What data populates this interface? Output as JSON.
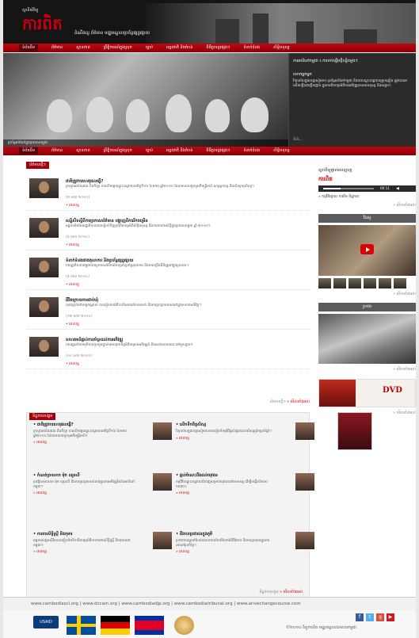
{
  "header": {
    "logo_small": "ស្ថានីយ៍វិទ្យុ",
    "logo_main": "ការពិត",
    "tagline": "ដំណឹងល្អ  ព័ត៌មាន  មជ្ឈមណ្ឌលប្រព័ន្ធផ្សព្វផ្សាយ"
  },
  "nav": [
    "ទំព័រដើម",
    "ព័ត៌មាន",
    "ស្ថានភាព",
    "ព្រឹត្តិការណ៍ក្នុងស្រុក",
    "ច្បាប់",
    "អន្តរជាតិ និងតំបន់",
    "ពិធីប្រារព្ធផ្សេងៗ",
    "ទំនាក់ទំនង",
    "សិទ្ធិមនុស្ស"
  ],
  "banner": {
    "caption": "ប្រព័ន្ធអប់រំនៅក្នុងប្រទេសកម្ពុជា",
    "title": "ការអប់រំនៅកម្ពុជា ៖ ការចាប់ផ្តើមថ្មីបន្តិចម្តងៗ",
    "heading": "លោកអ្នកអ្នក",
    "text": "វិទ្យាល័យក្នុងខេត្តសៀមរាប ប្រព័ន្ធអប់រំនៅកម្ពុជា និងការបណ្ដុះបណ្ដាលគ្រូបង្រៀន ត្រូវបានគេលើកឡើងជាញឹកញាប់ ក្នុងការពិភាក្សាអំពីការអភិវឌ្ឍធនធានមនុស្ស និងសង្គម។",
    "page_label": "ទំព័រ...",
    "more_label": "»"
  },
  "news": {
    "section_label": "ព័ត៌មានថ្មីៗ",
    "items": [
      {
        "title": "ជាតិត្រូវការហេតុផលធ្វើ?",
        "summary": "ក្រសួងអប់រំយុវជន និងកីឡា បានបើកវគ្គបណ្ដុះបណ្ដាលនៅថ្ងៃទី១៦ ខែមករា ឆ្នាំ២០១០ ដែលមានការចូលរួមពីមន្ត្រីអប់រំ សាស្ត្រាចារ្យ និងសិស្សានុសិស្ស។",
        "date": "(២ មករា ២០១០)",
        "more": "• អានបន្ត"
      },
      {
        "title": "សន្និសីទ​ស្ដីពីការប្រកាសព័ត៌មាន បង្ហាញពីការរីកចម្រើន",
        "summary": "អង្គការ​មិនមែន​រដ្ឋាភិបាល​បាន​រៀបចំ​កិច្ចប្រជុំ​ពិភាក្សា​អំពី​សិទ្ធិ​មនុស្ស និង​ការ​ការពារ​សិទ្ធិ​ក្នុង​ប្រទេស​កម្ពុជា ឆ្នាំ ២០១០។",
        "date": "(៦ មករា ២០១០)",
        "more": "• អានបន្ត"
      },
      {
        "title": "ទំនាក់ទំនង​រវាង​តុលាការ និង​ប្រព័ន្ធ​ផ្សព្វផ្សាយ",
        "summary": "រាជរដ្ឋាភិបាល​កម្ពុជា​បាន​ប្រកាស​អំពី​ការ​កែ​ទម្រង់​ប្រព័ន្ធ​តុលាការ និង​ការ​ពង្រឹង​នីតិរដ្ឋ​នៅ​ក្នុង​ប្រទេស។",
        "date": "(៨ មករា ២០១០)",
        "more": "• អានបន្ត"
      },
      {
        "title": "ជីវិត​ក្រោយ​ការ​ជាប់​ឃុំ",
        "summary": "បុរស​ម្នាក់​នៅ​ខេត្ត​កណ្ដាល បាន​រៀបរាប់​អំពី​បទពិសោធន៍​របស់​គាត់ និង​ការ​ត្រឡប់​មក​រស់នៅ​ក្នុង​សហគមន៍​វិញ។",
        "date": "(១២ មករា ២០១០)",
        "more": "• អានបន្ត"
      },
      {
        "title": "សហគមន៍​ផ្តល់​ការ​គាំទ្រ​ដល់​ការ​អភិវឌ្ឍ",
        "summary": "ពលរដ្ឋ​នៅ​តាម​ភូមិ​បាន​ចូលរួម​ក្នុង​ការ​សម្រេច​ចិត្ត​អំពី​គម្រោង​អភិវឌ្ឍន៍ និង​សេវា​សាធារណៈ​នៅ​មូលដ្ឋាន។",
        "date": "(១៤ មករា ២០១០)",
        "more": "• អានបន្ត"
      }
    ],
    "more_label": "ព័ត៌មានថ្មីៗ",
    "more_link": "» មើលទាំងអស់"
  },
  "bottom": {
    "section_label": "ទិដ្ឋភាពសង្គម",
    "items": [
      {
        "title": "• ជាតិត្រូវការហេតុផលធ្វើ?",
        "summary": "ក្រសួងអប់រំ​យុវជន និង​កីឡា បាន​បើក​វគ្គ​បណ្ដុះបណ្ដាល​នៅ​ថ្ងៃទី១៦ ខែមករា ឆ្នាំ២០១០ ដែល​មាន​ការ​ចូលរួម​ពី​មន្ត្រី​អប់រំ។",
        "more": "» អានបន្ត"
      },
      {
        "title": "• លើកទឹកចិត្តសិស្ស",
        "summary": "វិទ្យាល័យ​ក្នុង​ខេត្ត​សៀមរាប​បាន​រៀបចំ​កម្មវិធី​ផ្តល់​រង្វាន់​ដល់​សិស្ស​ពូកែ​ប្រចាំ​ឆ្នាំ។",
        "more": "» អានបន្ត"
      },
      {
        "title": "• កំណត់ត្រាលោក ម៉ុក ឈួនលី",
        "summary": "ប្រវត្តិ​របស់​លោក ម៉ុក ឈួនលី និង​ការ​ចូលរួម​របស់​គាត់​ក្នុង​ការ​អភិវឌ្ឍ​វិស័យ​អប់រំ​នៅ​កម្ពុជា។",
        "more": "» អានបន្ត"
      },
      {
        "title": "• ផ្តល់​ចំណេះដឹង​ដល់​យុវជន",
        "summary": "កម្មវិធី​បណ្ដុះបណ្ដាល​ជំនាញ​សម្រាប់​យុវជន​នៅ​តាម​ខេត្ត ដើម្បី​បង្កើន​ឱកាស​ការងារ។",
        "more": "» អានបន្ត"
      },
      {
        "title": "• ការពារសិទ្ធិស្ត្រី និងកុមារ",
        "summary": "អង្គការ​សង្គម​ស៊ីវិល​បាន​រៀបចំ​វេទិកា​ពិភាក្សា​អំពី​ការ​ការពារ​សិទ្ធិ​ស្ត្រី និង​កុមារ​នៅ​កម្ពុជា។",
        "more": "» អានបន្ត"
      },
      {
        "title": "• ជីវភាពប្រជាជនក្នុងភូមិ",
        "summary": "ប្រជាពលរដ្ឋ​នៅ​តំបន់​ជនបទ​បាន​ចែករំលែក​អំពី​ជីវភាព និង​ការ​ប្រឈម​ក្នុង​ការ​រស់នៅ​ប្រចាំថ្ងៃ។",
        "more": "» អានបន្ត"
      }
    ],
    "more_label": "ទិដ្ឋភាពសង្គម",
    "more_link": "» មើលទាំងអស់"
  },
  "sidebar": {
    "radio_title": "ស្ដាប់​វិទ្យុ​ផ្ទាល់​អនឡាញ",
    "radio_logo": "ការពិត",
    "radio_time": "00:11",
    "radio_link": "» កម្មវិធីផ្សាយ​ ការពិត ទិដ្ឋភាព",
    "radio_more": "» មើលទាំងអស់",
    "video_header": "វីដេអូ",
    "video_more": "» មើលទាំងអស់",
    "gallery_header": "រូបថត",
    "gallery_more": "» មើលទាំងអស់",
    "dvd_title": "DVD",
    "dvd_more": "» មើលទាំងអស់"
  },
  "footer": {
    "links": "www.cambodiasci.org  |  www.dccam.org  |  www.cambodiadjp.org  |  www.cambodiatribunal.org  |  www.arivechangecourse.com",
    "usaid": "USAID",
    "copyright": "©២០១០ វិទ្យុការពិត មជ្ឈមណ្ឌលឯកសារកម្ពុជា"
  }
}
